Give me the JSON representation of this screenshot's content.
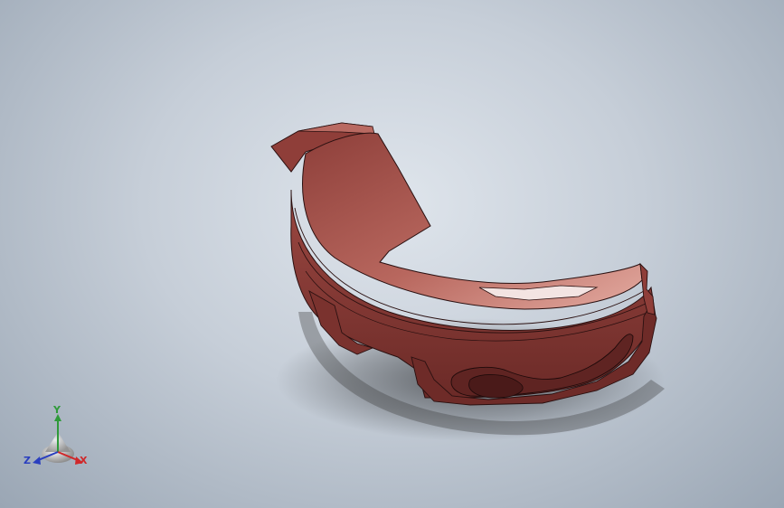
{
  "viewport": {
    "background_colors": [
      "#dfe5ec",
      "#9aa6b4"
    ],
    "model_color": "#a8544d"
  },
  "triad": {
    "x_label": "X",
    "y_label": "Y",
    "z_label": "Z",
    "x_color": "#d0282a",
    "y_color": "#2f9a3a",
    "z_color": "#2a3fbf"
  }
}
